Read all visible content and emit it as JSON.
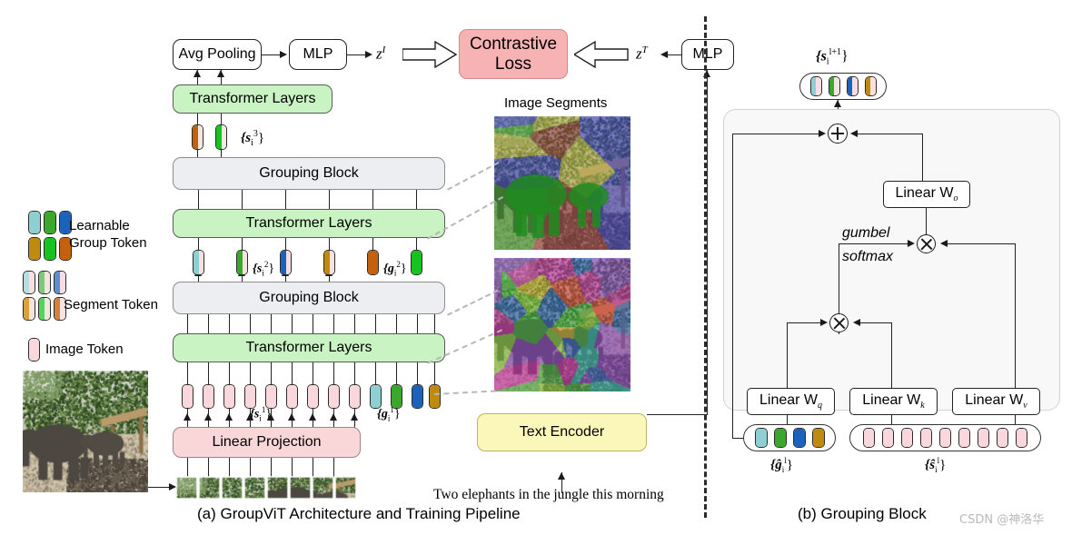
{
  "figure": {
    "captions": {
      "a": "(a) GroupViT Architecture and Training Pipeline",
      "b": "(b) Grouping Block"
    },
    "watermark": "CSDN @神洛华"
  },
  "panel_a": {
    "boxes": {
      "avg_pooling": "Avg Pooling",
      "mlp_image": "MLP",
      "mlp_text": "MLP",
      "contrastive_loss": "Contrastive Loss",
      "transformer_layers_3": "Transformer Layers",
      "transformer_layers_2": "Transformer Layers",
      "transformer_layers_1": "Transformer Layers",
      "grouping_block_2": "Grouping Block",
      "grouping_block_1": "Grouping Block",
      "linear_projection": "Linear Projection",
      "text_encoder": "Text Encoder"
    },
    "symbols": {
      "z_image": "z",
      "z_image_sup": "I",
      "z_text": "z",
      "z_text_sup": "T",
      "s3": "{s",
      "s3_sub": "i",
      "s3_sup": "3",
      "s2_sup": "2",
      "s1_sup": "1",
      "g2": "{g",
      "g2_sup": "2",
      "g1_sup": "1",
      "brace_close": "}"
    },
    "labels": {
      "image_segments": "Image Segments",
      "learnable_group_token": "Learnable\nGroup Token",
      "learnable_line1": "Learnable",
      "learnable_line2": "Group Token",
      "segment_token": "Segment Token",
      "image_token": "Image Token",
      "caption_text": "Two elephants in the jungle this morning"
    }
  },
  "panel_b": {
    "boxes": {
      "linear_wo": "Linear W",
      "linear_wo_sub": "o",
      "linear_wq": "Linear W",
      "linear_wq_sub": "q",
      "linear_wk": "Linear W",
      "linear_wk_sub": "k",
      "linear_wv": "Linear W",
      "linear_wv_sub": "v"
    },
    "labels": {
      "gumbel": "gumbel",
      "softmax": "softmax"
    },
    "symbols": {
      "s_out": "{s",
      "s_out_sub": "i",
      "s_out_sup": "l+1",
      "g_in": "{ĝ",
      "g_in_sub": "i",
      "g_in_sup": "l",
      "s_in": "{ŝ",
      "s_in_sub": "i",
      "s_in_sup": "l",
      "close": "}"
    }
  },
  "colors": {
    "green_block": "#c9f3c2",
    "grey_block": "#eceef2",
    "pink_block": "#f9d7d9",
    "red_block": "#f7b3b3",
    "yellow_block": "#fbf7bb",
    "token_pink": "#f9d7dc",
    "token_teal": "#8ecfd3",
    "token_green": "#3aa82b",
    "token_blue": "#1b63ba",
    "token_gold": "#c08a0e",
    "token_orange": "#c4610d",
    "token_lightgreen": "#17c41f",
    "dashed_grey": "#b7b7b7"
  },
  "token_rows": {
    "s3": [
      {
        "left": "#c4610d",
        "right": "#f7e6e0"
      },
      {
        "left": "#17c41f",
        "right": "#f0e9e4"
      }
    ],
    "s2": [
      {
        "left": "#8ecfd3",
        "right": "#f9dfe2"
      },
      {
        "left": "#3aa82b",
        "right": "#f4e3e0"
      },
      {
        "left": "#1b63ba",
        "right": "#f7dde2"
      },
      {
        "left": "#c08a0e",
        "right": "#f7e2e0"
      }
    ],
    "g2": [
      {
        "solid": "#c4610d"
      },
      {
        "solid": "#17c41f"
      }
    ],
    "s1_count": 9,
    "s1_color": "#f9d7dc",
    "g1": [
      "#8ecfd3",
      "#3aa82b",
      "#1b63ba",
      "#c08a0e"
    ],
    "legend_group_row1": [
      "#8ecfd3",
      "#3aa82b",
      "#1b63ba"
    ],
    "legend_group_row2": [
      "#c08a0e",
      "#17c41f",
      "#c4610d"
    ],
    "legend_segment_row1": [
      {
        "left": "#b6dde0",
        "right": "#f9dfe2"
      },
      {
        "left": "#7ec978",
        "right": "#f4e3e0"
      },
      {
        "left": "#5d8fd0",
        "right": "#f7dde2"
      }
    ],
    "legend_segment_row2": [
      {
        "left": "#d8a33e",
        "right": "#f7e2e0"
      },
      {
        "left": "#55d45c",
        "right": "#f1e7e2"
      },
      {
        "left": "#d4803f",
        "right": "#f7e3df"
      }
    ],
    "legend_image": "#f9d7dc",
    "b_top": [
      {
        "left": "#8ecfd3",
        "right": "#f9dfe2"
      },
      {
        "left": "#3aa82b",
        "right": "#f4e3e0"
      },
      {
        "left": "#1b63ba",
        "right": "#f7dde2"
      },
      {
        "left": "#c08a0e",
        "right": "#f7e2e0"
      }
    ],
    "b_g": [
      "#8ecfd3",
      "#3aa82b",
      "#1b63ba",
      "#c08a0e"
    ],
    "b_s_count": 9,
    "b_s_color": "#f9d7dc"
  }
}
